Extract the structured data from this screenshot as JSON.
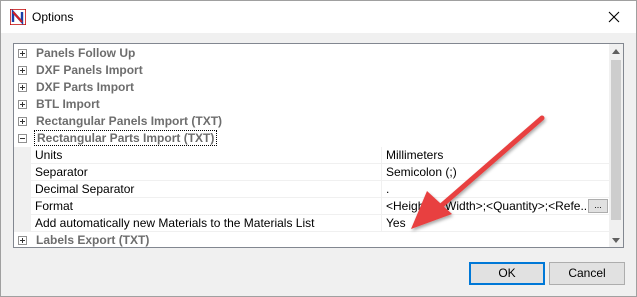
{
  "window": {
    "title": "Options"
  },
  "categories_top": [
    {
      "label": "Panels Follow Up"
    },
    {
      "label": "DXF Panels Import"
    },
    {
      "label": "DXF Parts Import"
    },
    {
      "label": "BTL Import"
    },
    {
      "label": "Rectangular Panels Import (TXT)"
    },
    {
      "label": "Rectangular Parts Import (TXT)"
    }
  ],
  "properties": [
    {
      "name": "Units",
      "value": "Millimeters"
    },
    {
      "name": "Separator",
      "value": "Semicolon (;)"
    },
    {
      "name": "Decimal Separator",
      "value": "."
    },
    {
      "name": "Format",
      "value": "<Height>;<Width>;<Quantity>;<Refe..."
    },
    {
      "name": "Add automatically new Materials to the Materials List",
      "value": "Yes"
    }
  ],
  "categories_bottom": [
    {
      "label": "Labels Export (TXT)"
    }
  ],
  "format_button_label": "...",
  "buttons": {
    "ok": "OK",
    "cancel": "Cancel"
  },
  "colors": {
    "arrow": "#e8403f",
    "default_button_border": "#0078d7",
    "category_text": "#6d6d6d"
  },
  "icons": [
    "app-logo-icon",
    "close-icon",
    "scroll-up-icon",
    "scroll-down-icon"
  ]
}
